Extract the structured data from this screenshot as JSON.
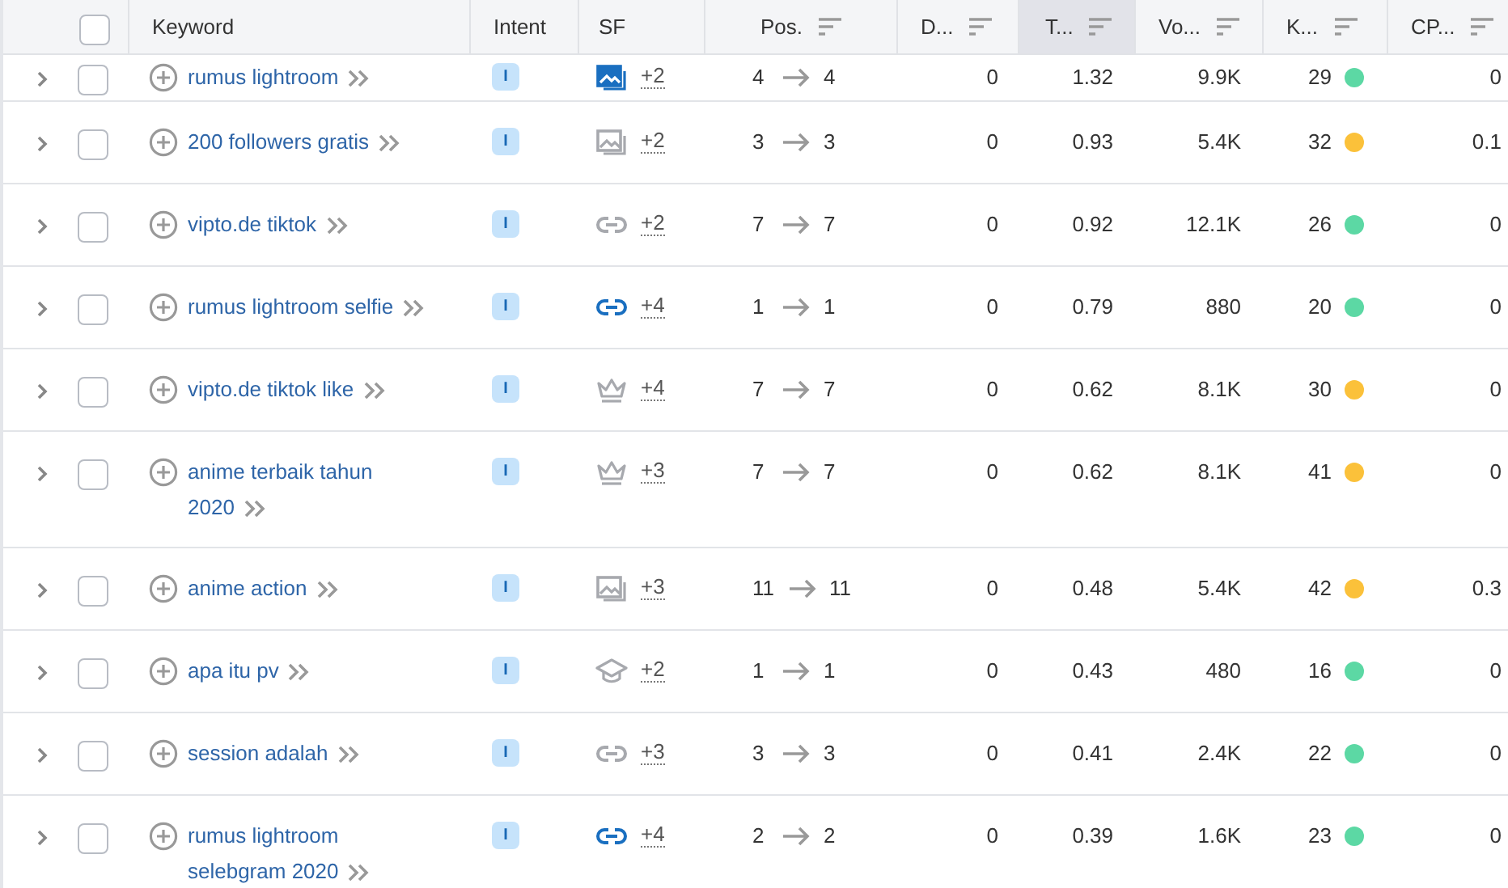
{
  "table": {
    "header_checkbox": {
      "checked": false
    },
    "columns": [
      {
        "label": "Keyword",
        "sortable": false,
        "sorted": false
      },
      {
        "label": "Intent",
        "sortable": false,
        "sorted": false
      },
      {
        "label": "SF",
        "sortable": false,
        "sorted": false
      },
      {
        "label": "Pos.",
        "sortable": true,
        "sorted": false
      },
      {
        "label": "D...",
        "sortable": true,
        "sorted": false
      },
      {
        "label": "T...",
        "sortable": true,
        "sorted": true
      },
      {
        "label": "Vo...",
        "sortable": true,
        "sorted": false
      },
      {
        "label": "K...",
        "sortable": true,
        "sorted": false
      },
      {
        "label": "CP...",
        "sortable": true,
        "sorted": false
      }
    ],
    "rows": [
      {
        "expanded": false,
        "checked": false,
        "keyword": "rumus lightroom",
        "intent": "I",
        "kind": "image",
        "sf_active": true,
        "sf_more": "+2",
        "pos_from": "4",
        "pos_to": "4",
        "d": "0",
        "t": "1.32",
        "vo": "9.9K",
        "k": "29",
        "color": "#5cd8a4",
        "cp": "0"
      },
      {
        "expanded": false,
        "checked": false,
        "keyword": "200 followers gratis",
        "intent": "I",
        "kind": "image",
        "sf_active": false,
        "sf_more": "+2",
        "pos_from": "3",
        "pos_to": "3",
        "d": "0",
        "t": "0.93",
        "vo": "5.4K",
        "k": "32",
        "color": "#fbc13a",
        "cp": "0.1"
      },
      {
        "expanded": false,
        "checked": false,
        "keyword": "vipto.de tiktok",
        "intent": "I",
        "kind": "link",
        "sf_active": false,
        "sf_more": "+2",
        "pos_from": "7",
        "pos_to": "7",
        "d": "0",
        "t": "0.92",
        "vo": "12.1K",
        "k": "26",
        "color": "#5cd8a4",
        "cp": "0"
      },
      {
        "expanded": false,
        "checked": false,
        "keyword": "rumus lightroom selfie",
        "intent": "I",
        "kind": "link",
        "sf_active": true,
        "sf_more": "+4",
        "pos_from": "1",
        "pos_to": "1",
        "d": "0",
        "t": "0.79",
        "vo": "880",
        "k": "20",
        "color": "#5cd8a4",
        "cp": "0"
      },
      {
        "expanded": false,
        "checked": false,
        "keyword": "vipto.de tiktok like",
        "intent": "I",
        "kind": "crown",
        "sf_active": false,
        "sf_more": "+4",
        "pos_from": "7",
        "pos_to": "7",
        "d": "0",
        "t": "0.62",
        "vo": "8.1K",
        "k": "30",
        "color": "#fbc13a",
        "cp": "0"
      },
      {
        "expanded": false,
        "checked": false,
        "keyword": "anime terbaik tahun 2020",
        "intent": "I",
        "kind": "crown",
        "sf_active": false,
        "sf_more": "+3",
        "pos_from": "7",
        "pos_to": "7",
        "d": "0",
        "t": "0.62",
        "vo": "8.1K",
        "k": "41",
        "color": "#fbc13a",
        "cp": "0"
      },
      {
        "expanded": false,
        "checked": false,
        "keyword": "anime action",
        "intent": "I",
        "kind": "image",
        "sf_active": false,
        "sf_more": "+3",
        "pos_from": "11",
        "pos_to": "11",
        "d": "0",
        "t": "0.48",
        "vo": "5.4K",
        "k": "42",
        "color": "#fbc13a",
        "cp": "0.3"
      },
      {
        "expanded": false,
        "checked": false,
        "keyword": "apa itu pv",
        "intent": "I",
        "kind": "cap",
        "sf_active": false,
        "sf_more": "+2",
        "pos_from": "1",
        "pos_to": "1",
        "d": "0",
        "t": "0.43",
        "vo": "480",
        "k": "16",
        "color": "#5cd8a4",
        "cp": "0"
      },
      {
        "expanded": false,
        "checked": false,
        "keyword": "session adalah",
        "intent": "I",
        "kind": "link",
        "sf_active": false,
        "sf_more": "+3",
        "pos_from": "3",
        "pos_to": "3",
        "d": "0",
        "t": "0.41",
        "vo": "2.4K",
        "k": "22",
        "color": "#5cd8a4",
        "cp": "0"
      },
      {
        "expanded": false,
        "checked": false,
        "keyword": "rumus lightroom selebgram 2020",
        "intent": "I",
        "kind": "link",
        "sf_active": true,
        "sf_more": "+4",
        "pos_from": "2",
        "pos_to": "2",
        "d": "0",
        "t": "0.39",
        "vo": "1.6K",
        "k": "23",
        "color": "#5cd8a4",
        "cp": "0"
      }
    ]
  }
}
